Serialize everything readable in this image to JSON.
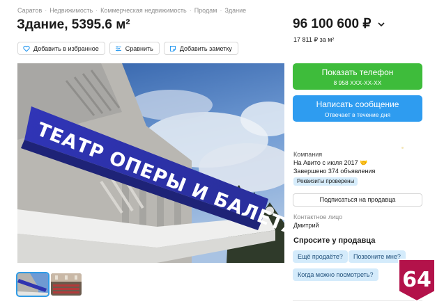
{
  "breadcrumb": [
    "Саратов",
    "Недвижимость",
    "Коммерческая недвижимость",
    "Продам",
    "Здание"
  ],
  "breadcrumb_separator": "·",
  "title": "Здание, 5395.6 м²",
  "actions": {
    "favorite": "Добавить в избранное",
    "compare": "Сравнить",
    "note": "Добавить заметку"
  },
  "photo": {
    "sign_line1": "ТЕАТР ОПЕРЫ И БАЛЕТА"
  },
  "price": {
    "value": "96 100 600 ₽",
    "per_sqm": "17 811 ₽ за м²"
  },
  "contact_buttons": {
    "phone_label": "Показать телефон",
    "phone_number": "8 958 XXX-XX-XX",
    "message_label": "Написать сообщение",
    "message_sub": "Отвечает в течение дня"
  },
  "seller": {
    "kind": "Компания",
    "since": "На Авито с июля 2017",
    "since_icon": "handshake-icon",
    "completed": "Завершено 374 объявления",
    "verified_badge": "Реквизиты проверены",
    "subscribe": "Подписаться на продавца"
  },
  "contact_person": {
    "label": "Контактное лицо",
    "name": "Дмитрий"
  },
  "ask": {
    "title": "Спросите у продавца",
    "chips": [
      "Ещё продаёте?",
      "Позвоните мне?",
      "Когда можно посмотреть?"
    ]
  },
  "watermark_badge": "64",
  "colors": {
    "phone_button": "#3ebc3b",
    "message_button": "#2e9cf0",
    "chip_bg": "#d4ebfb",
    "badge": "#b3124a"
  }
}
